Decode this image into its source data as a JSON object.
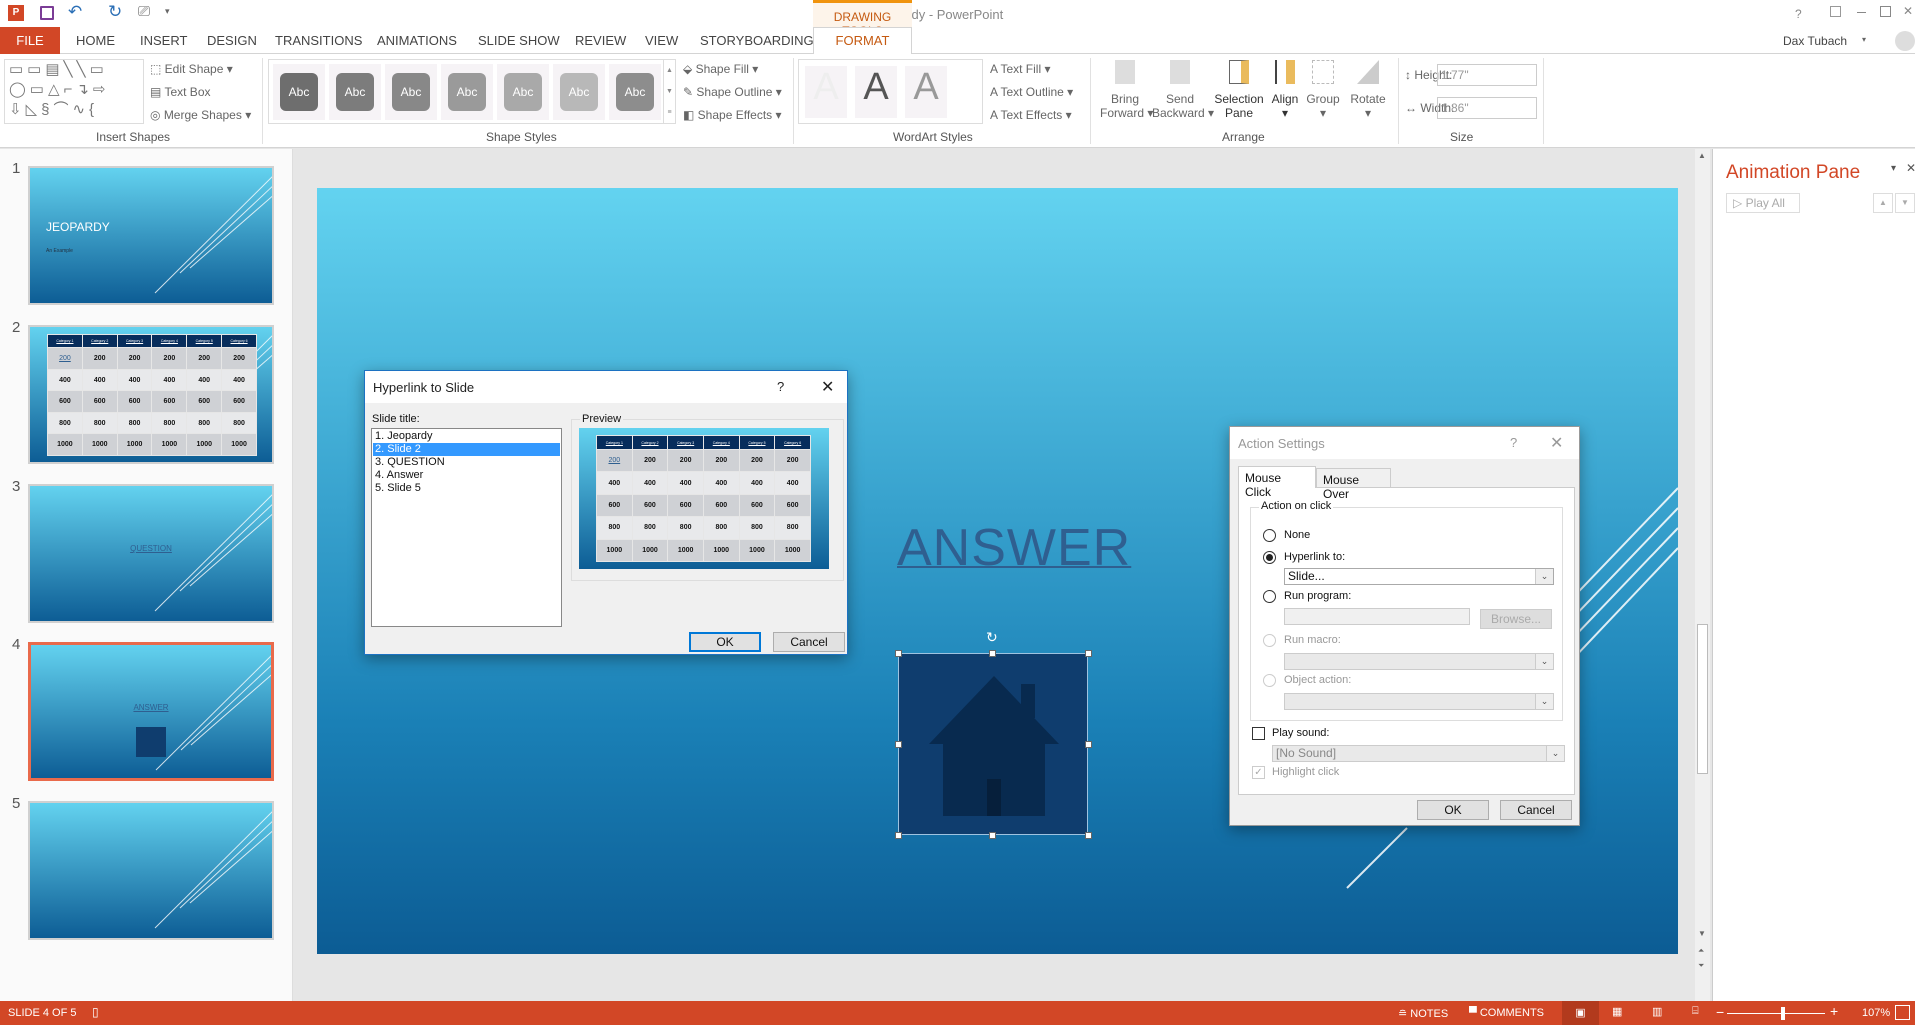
{
  "app": {
    "title": "Jeopardy - PowerPoint",
    "user": "Dax Tubach",
    "context_tab_group": "DRAWING TOOLS"
  },
  "colors": {
    "accent": "#d24726",
    "selection": "#3399ff",
    "slide_dark": "#072d5c"
  },
  "tabs": [
    "FILE",
    "HOME",
    "INSERT",
    "DESIGN",
    "TRANSITIONS",
    "ANIMATIONS",
    "SLIDE SHOW",
    "REVIEW",
    "VIEW",
    "STORYBOARDING",
    "FORMAT"
  ],
  "active_tab": "FORMAT",
  "ribbon": {
    "insert_shapes": {
      "label": "Insert Shapes",
      "edit_shape": "Edit Shape",
      "text_box": "Text Box",
      "merge_shapes": "Merge Shapes"
    },
    "shape_styles": {
      "label": "Shape Styles",
      "sample": "Abc",
      "shape_fill": "Shape Fill",
      "shape_outline": "Shape Outline",
      "shape_effects": "Shape Effects"
    },
    "wordart_styles": {
      "label": "WordArt Styles",
      "sample": "A",
      "text_fill": "Text Fill",
      "text_outline": "Text Outline",
      "text_effects": "Text Effects"
    },
    "arrange": {
      "label": "Arrange",
      "bring_forward": [
        "Bring",
        "Forward"
      ],
      "send_backward": [
        "Send",
        "Backward"
      ],
      "selection_pane": [
        "Selection",
        "Pane"
      ],
      "align": "Align",
      "group": "Group",
      "rotate": "Rotate"
    },
    "size": {
      "label": "Size",
      "height_label": "Height:",
      "height_value": "1.77\"",
      "width_label": "Width:",
      "width_value": "1.86\""
    }
  },
  "slides": [
    {
      "num": "1",
      "title": "JEOPARDY",
      "subtitle": "An Example"
    },
    {
      "num": "2"
    },
    {
      "num": "3",
      "title": "QUESTION"
    },
    {
      "num": "4",
      "title": "ANSWER",
      "selected": true
    },
    {
      "num": "5"
    }
  ],
  "jeopardy": {
    "categories": [
      "Category 1",
      "Category 2",
      "Category 3",
      "Category 4",
      "Category 5",
      "Category 6"
    ],
    "values": [
      "200",
      "400",
      "600",
      "800",
      "1000"
    ]
  },
  "slide_canvas": {
    "heading": "ANSWER",
    "shape": "home-icon"
  },
  "animation_pane": {
    "title": "Animation Pane",
    "play_all": "Play All"
  },
  "hyperlink_dialog": {
    "title": "Hyperlink to Slide",
    "help": "?",
    "slide_title_label": "Slide title:",
    "items": [
      "1. Jeopardy",
      "2. Slide 2",
      "3. QUESTION",
      "4. Answer",
      "5. Slide 5"
    ],
    "selected_index": 1,
    "preview_label": "Preview",
    "ok": "OK",
    "cancel": "Cancel"
  },
  "action_dialog": {
    "title": "Action Settings",
    "help": "?",
    "tabs": [
      "Mouse Click",
      "Mouse Over"
    ],
    "group_label": "Action on click",
    "none": "None",
    "hyperlink_to": "Hyperlink to:",
    "hyperlink_value": "Slide...",
    "run_program": "Run program:",
    "browse": "Browse...",
    "run_macro": "Run macro:",
    "object_action": "Object action:",
    "play_sound": "Play sound:",
    "sound_value": "[No Sound]",
    "highlight_click": "Highlight click",
    "ok": "OK",
    "cancel": "Cancel",
    "selected_option": "Hyperlink to:"
  },
  "status": {
    "slide_info": "SLIDE 4 OF 5",
    "notes": "NOTES",
    "comments": "COMMENTS",
    "zoom": "107%",
    "zoom_level_percent": 107
  }
}
